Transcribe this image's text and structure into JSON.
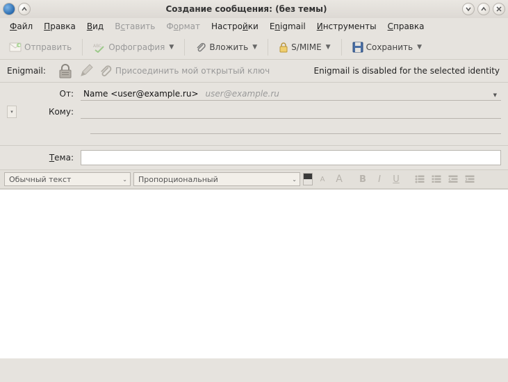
{
  "title": "Создание сообщения: (без темы)",
  "menu": {
    "file": {
      "pre": "",
      "u": "Ф",
      "post": "айл"
    },
    "edit": {
      "pre": "",
      "u": "П",
      "post": "равка"
    },
    "view": {
      "pre": "",
      "u": "В",
      "post": "ид"
    },
    "insert": {
      "pre": "В",
      "u": "с",
      "post": "тавить"
    },
    "format": {
      "pre": "Ф",
      "u": "о",
      "post": "рмат"
    },
    "options": {
      "pre": "Настро",
      "u": "й",
      "post": "ки"
    },
    "enigmail": {
      "pre": "E",
      "u": "n",
      "post": "igmail"
    },
    "tools": {
      "pre": "",
      "u": "И",
      "post": "нструменты"
    },
    "help": {
      "pre": "",
      "u": "С",
      "post": "правка"
    }
  },
  "toolbar": {
    "send": "Отправить",
    "spell": "Орфография",
    "attach": "Вложить",
    "smime": "S/MIME",
    "save": "Сохранить"
  },
  "enigmail": {
    "label": "Enigmail:",
    "attach_key": "Присоединить мой открытый ключ",
    "status": "Enigmail is disabled for the selected identity"
  },
  "headers": {
    "from_label": "От:",
    "from_display": "Name <user@example.ru>",
    "from_email": "user@example.ru",
    "to_label": "Кому:",
    "to_value": ""
  },
  "subject": {
    "label_pre": "",
    "label_u": "Т",
    "label_post": "ема:",
    "value": ""
  },
  "fmt": {
    "paragraph": "Обычный текст",
    "font": "Пропорциональный",
    "fg_color": "#3a3a3a",
    "bg_color": "#e6e3de"
  }
}
